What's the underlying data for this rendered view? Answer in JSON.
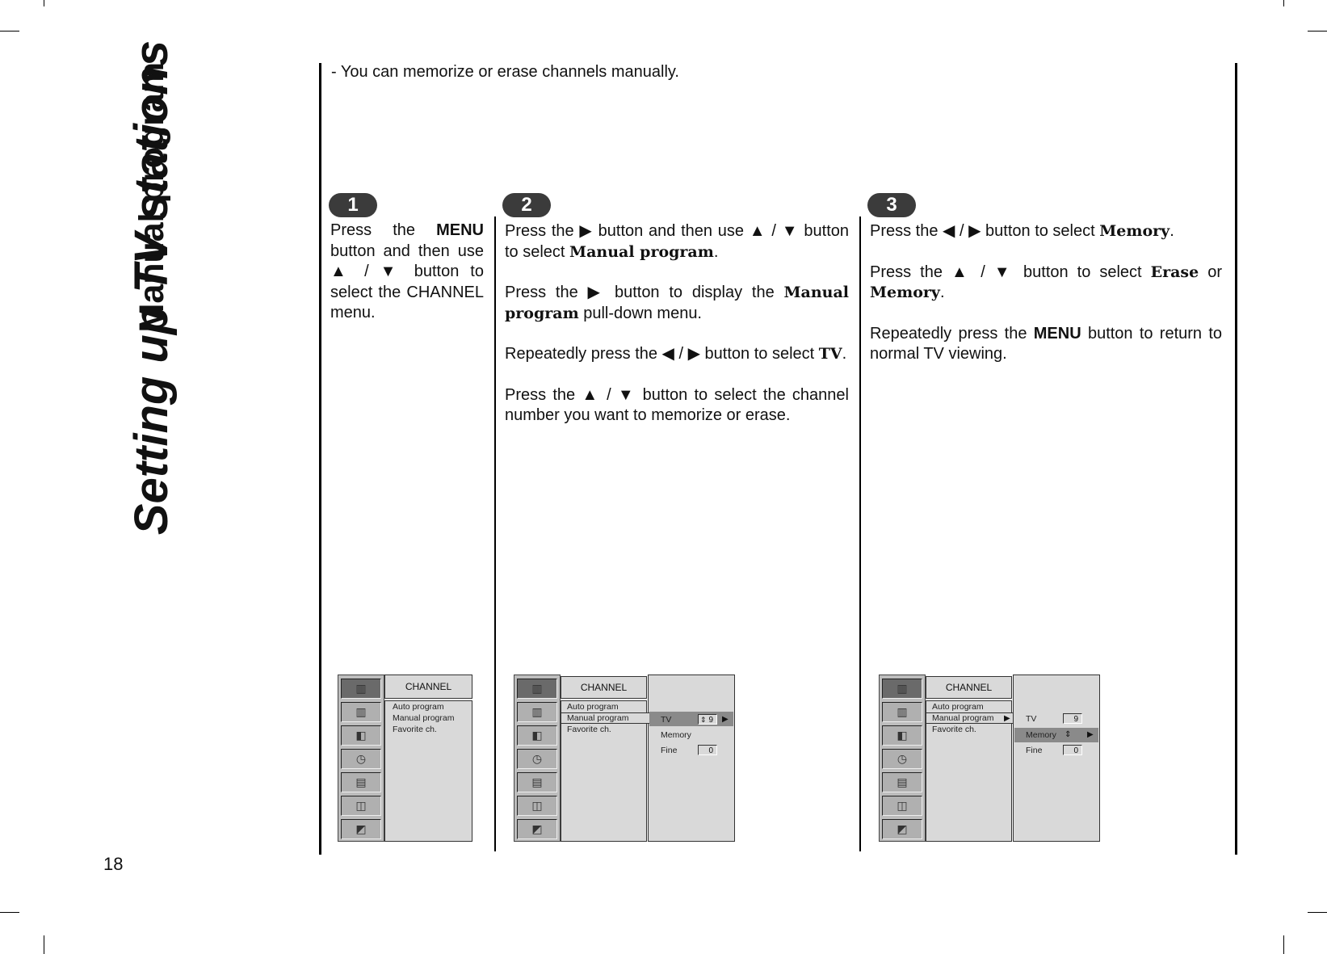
{
  "page": {
    "title": "Setting up TV stations",
    "subtitle": "Manual program",
    "page_number": "18",
    "intro": "-  You can memorize or erase channels manually."
  },
  "steps": [
    {
      "number": "1",
      "paragraphs": [
        [
          {
            "t": "Press the "
          },
          {
            "t": "MENU",
            "s": "b"
          },
          {
            "t": " button and then use ▲ / ▼ button to select the CHANNEL menu."
          }
        ]
      ]
    },
    {
      "number": "2",
      "paragraphs": [
        [
          {
            "t": "Press the ▶ button and then use ▲ / ▼ button to select "
          },
          {
            "t": "Manual program",
            "s": "bs"
          },
          {
            "t": "."
          }
        ],
        [
          {
            "t": "Press the ▶ button to display the "
          },
          {
            "t": "Manual program",
            "s": "bs"
          },
          {
            "t": " pull-down menu."
          }
        ],
        [
          {
            "t": "Repeatedly press the ◀ / ▶ button to select "
          },
          {
            "t": "TV",
            "s": "bs"
          },
          {
            "t": "."
          }
        ],
        [
          {
            "t": "Press the ▲ / ▼ button to select the channel number you want to memorize or erase."
          }
        ]
      ]
    },
    {
      "number": "3",
      "paragraphs": [
        [
          {
            "t": "Press the ◀ / ▶ button to select "
          },
          {
            "t": "Memory",
            "s": "bs"
          },
          {
            "t": "."
          }
        ],
        [
          {
            "t": "Press the ▲ / ▼ button to select "
          },
          {
            "t": "Erase",
            "s": "bs"
          },
          {
            "t": " or "
          },
          {
            "t": "Memory",
            "s": "bs"
          },
          {
            "t": "."
          }
        ],
        [
          {
            "t": "Repeatedly press the "
          },
          {
            "t": "MENU",
            "s": "b"
          },
          {
            "t": " button to return to normal TV viewing."
          }
        ]
      ]
    }
  ],
  "osd": {
    "menu_title": "CHANNEL",
    "items": [
      "Auto program",
      "Manual program",
      "Favorite ch."
    ],
    "side_icons": [
      "tv-channel-icon",
      "picture-icon",
      "sound-icon",
      "timer-icon",
      "special-icon",
      "screen-icon",
      "lock-icon"
    ],
    "side_glyphs": [
      "▥",
      "▥",
      "◧",
      "◷",
      "▤",
      "◫",
      "◩"
    ],
    "submenu": {
      "tv_label": "TV",
      "tv_value": "9",
      "memory_label": "Memory",
      "fine_label": "Fine",
      "fine_value": "0",
      "updown_glyph": "⇕",
      "right_arrow": "▶"
    }
  }
}
